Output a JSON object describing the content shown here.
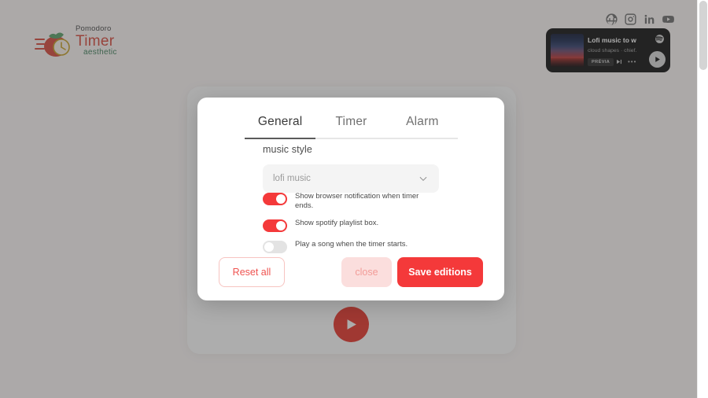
{
  "brand": {
    "line1": "Pomodoro",
    "line2": "Timer",
    "line3": "aesthetic",
    "accent_color": "#d94a3d",
    "green_color": "#3f7f5a"
  },
  "socials": [
    {
      "name": "website-icon",
      "label": "Website"
    },
    {
      "name": "instagram-icon",
      "label": "Instagram"
    },
    {
      "name": "linkedin-icon",
      "label": "LinkedIn"
    },
    {
      "name": "youtube-icon",
      "label": "YouTube"
    }
  ],
  "player": {
    "title": "Lofi music to w",
    "artist": "cloud shapes  ·  chief.",
    "badge": "PRÉVIA",
    "more": "•••",
    "provider_icon": "spotify-icon",
    "play_icon": "play-icon",
    "next_icon": "skip-next-icon"
  },
  "modal": {
    "tabs": [
      {
        "label": "General",
        "active": true
      },
      {
        "label": "Timer",
        "active": false
      },
      {
        "label": "Alarm",
        "active": false
      }
    ],
    "music_style": {
      "label": "music style",
      "value": "lofi music",
      "placeholder": "lofi music",
      "chevron_icon": "chevron-down-icon"
    },
    "toggles": [
      {
        "label": "Show browser notification when timer ends.",
        "on": true
      },
      {
        "label": "Show spotify playlist box.",
        "on": true
      },
      {
        "label": "Play a song when the timer starts.",
        "on": false
      }
    ],
    "buttons": {
      "reset": "Reset all",
      "close": "close",
      "save": "Save editions"
    },
    "accent_red": "#f4393a",
    "soft_pink": "#fbdedd"
  },
  "timer": {
    "play_icon": "play-icon"
  }
}
